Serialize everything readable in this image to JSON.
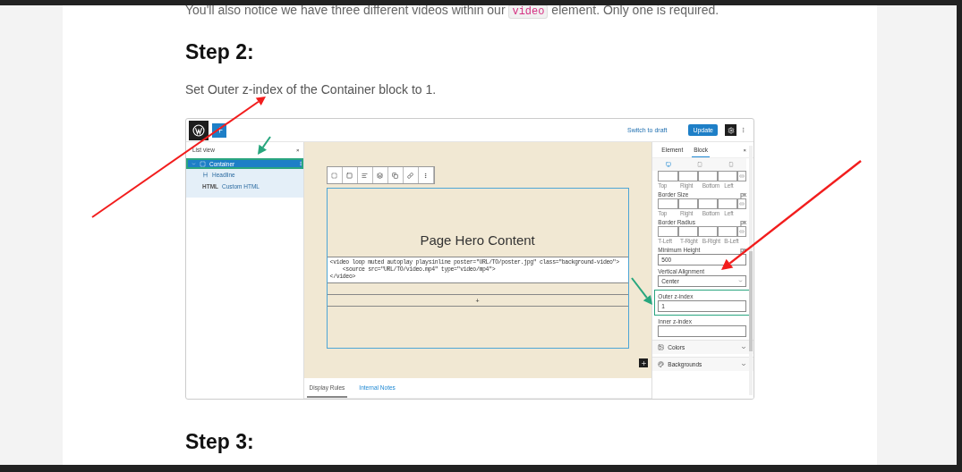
{
  "intro": {
    "before": "You'll also notice we have three different videos within our ",
    "code": "video",
    "after": " element. Only one is required."
  },
  "step2": {
    "heading": "Step 2:",
    "text": "Set Outer z-index of the Container block to 1."
  },
  "editor": {
    "topbar": {
      "link": "Switch to draft",
      "button": "Update"
    },
    "list_view": {
      "title": "List view",
      "close": "×",
      "items": [
        {
          "label": "Container",
          "selected": true,
          "highlighted": true,
          "children": [
            {
              "label": "Headline",
              "selected": false
            },
            {
              "label": "Custom HTML",
              "icon_text": "HTML",
              "selected": false
            }
          ]
        }
      ]
    },
    "canvas": {
      "hero": "Page Hero Content",
      "code_lines": [
        "<video loop muted autoplay playsinline poster=\"URL/TO/poster.jpg\" class=\"background-video\">",
        "    <source src=\"URL/TO/video.mp4\" type=\"video/mp4\">",
        "</video>"
      ],
      "add_row": "+"
    },
    "bottom_tabs": [
      {
        "label": "Display Rules",
        "selected": true
      },
      {
        "label": "Internal Notes",
        "selected": false
      }
    ],
    "sidebar": {
      "tabs": [
        {
          "label": "Element",
          "selected": false
        },
        {
          "label": "Block",
          "selected": true
        }
      ],
      "close": "×",
      "sections": [
        {
          "kind": "boxes",
          "sublabels": [
            "Top",
            "Right",
            "Bottom",
            "Left"
          ]
        },
        {
          "kind": "boxes",
          "label": "Border Size",
          "units": "px",
          "sublabels": [
            "Top",
            "Right",
            "Bottom",
            "Left"
          ]
        },
        {
          "kind": "boxes",
          "label": "Border Radius",
          "units": "px",
          "sublabels": [
            "T-Left",
            "T-Right",
            "B-Right",
            "B-Left"
          ]
        },
        {
          "kind": "input",
          "label": "Minimum Height",
          "units": "px",
          "value": "500",
          "highlighted": false
        },
        {
          "kind": "select",
          "label": "Vertical Alignment",
          "value": "Center"
        },
        {
          "kind": "input",
          "label": "Outer z-index",
          "value": "1",
          "highlighted": true
        },
        {
          "kind": "input",
          "label": "Inner z-index",
          "highlighted": false
        },
        {
          "kind": "panel",
          "label": "Colors"
        },
        {
          "kind": "panel",
          "label": "Backgrounds"
        }
      ]
    }
  },
  "step3": {
    "heading": "Step 3:"
  }
}
